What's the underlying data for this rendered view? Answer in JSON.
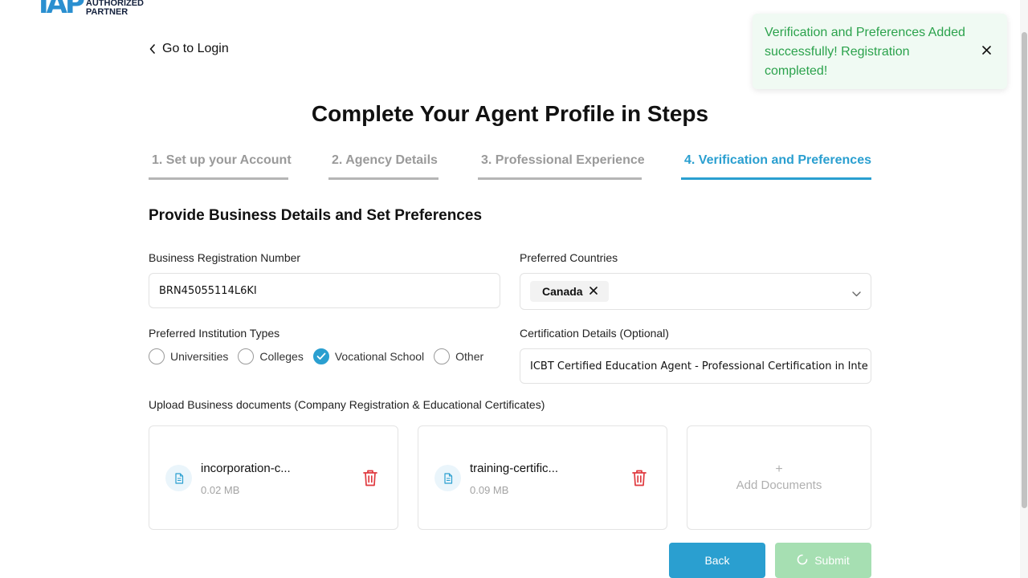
{
  "brand": {
    "mark": "IAP",
    "line1": "AUTHORIZED",
    "line2": "PARTNER",
    "color": "#2a8fd0"
  },
  "nav": {
    "back_label": "Go to Login"
  },
  "page": {
    "title": "Complete Your Agent Profile in Steps"
  },
  "steps": [
    {
      "label": "1. Set up your Account",
      "active": false
    },
    {
      "label": "2. Agency Details",
      "active": false
    },
    {
      "label": "3. Professional Experience",
      "active": false
    },
    {
      "label": "4. Verification and Preferences",
      "active": true
    }
  ],
  "section": {
    "title": "Provide Business Details and Set Preferences"
  },
  "form": {
    "business_reg": {
      "label": "Business Registration Number",
      "value": "BRN45055114L6KI"
    },
    "countries": {
      "label": "Preferred Countries",
      "selected": [
        "Canada"
      ]
    },
    "institution_types": {
      "label": "Preferred Institution Types",
      "options": [
        {
          "label": "Universities",
          "checked": false
        },
        {
          "label": "Colleges",
          "checked": false
        },
        {
          "label": "Vocational School",
          "checked": true
        },
        {
          "label": "Other",
          "checked": false
        }
      ]
    },
    "certification": {
      "label": "Certification Details (Optional)",
      "value": "ICBT Certified Education Agent - Professional Certification in Inte"
    }
  },
  "upload": {
    "label": "Upload Business documents (Company Registration & Educational Certificates)",
    "documents": [
      {
        "name": "incorporation-c...",
        "size": "0.02 MB"
      },
      {
        "name": "training-certific...",
        "size": "0.09 MB"
      }
    ],
    "add_plus": "+",
    "add_label": "Add Documents"
  },
  "buttons": {
    "back": "Back",
    "submit": "Submit"
  },
  "toast": {
    "message": "Verification and Preferences Added successfully! Registration completed!"
  },
  "colors": {
    "accent": "#2a9fd0",
    "success": "#2ba24c",
    "danger": "#e0393e",
    "submit_disabled": "#a6dfb2"
  },
  "icons": {
    "back": "chevron-left-icon",
    "dropdown": "chevron-down-icon",
    "document": "file-icon",
    "delete": "trash-icon",
    "close": "close-icon",
    "spinner": "spinner-icon"
  }
}
